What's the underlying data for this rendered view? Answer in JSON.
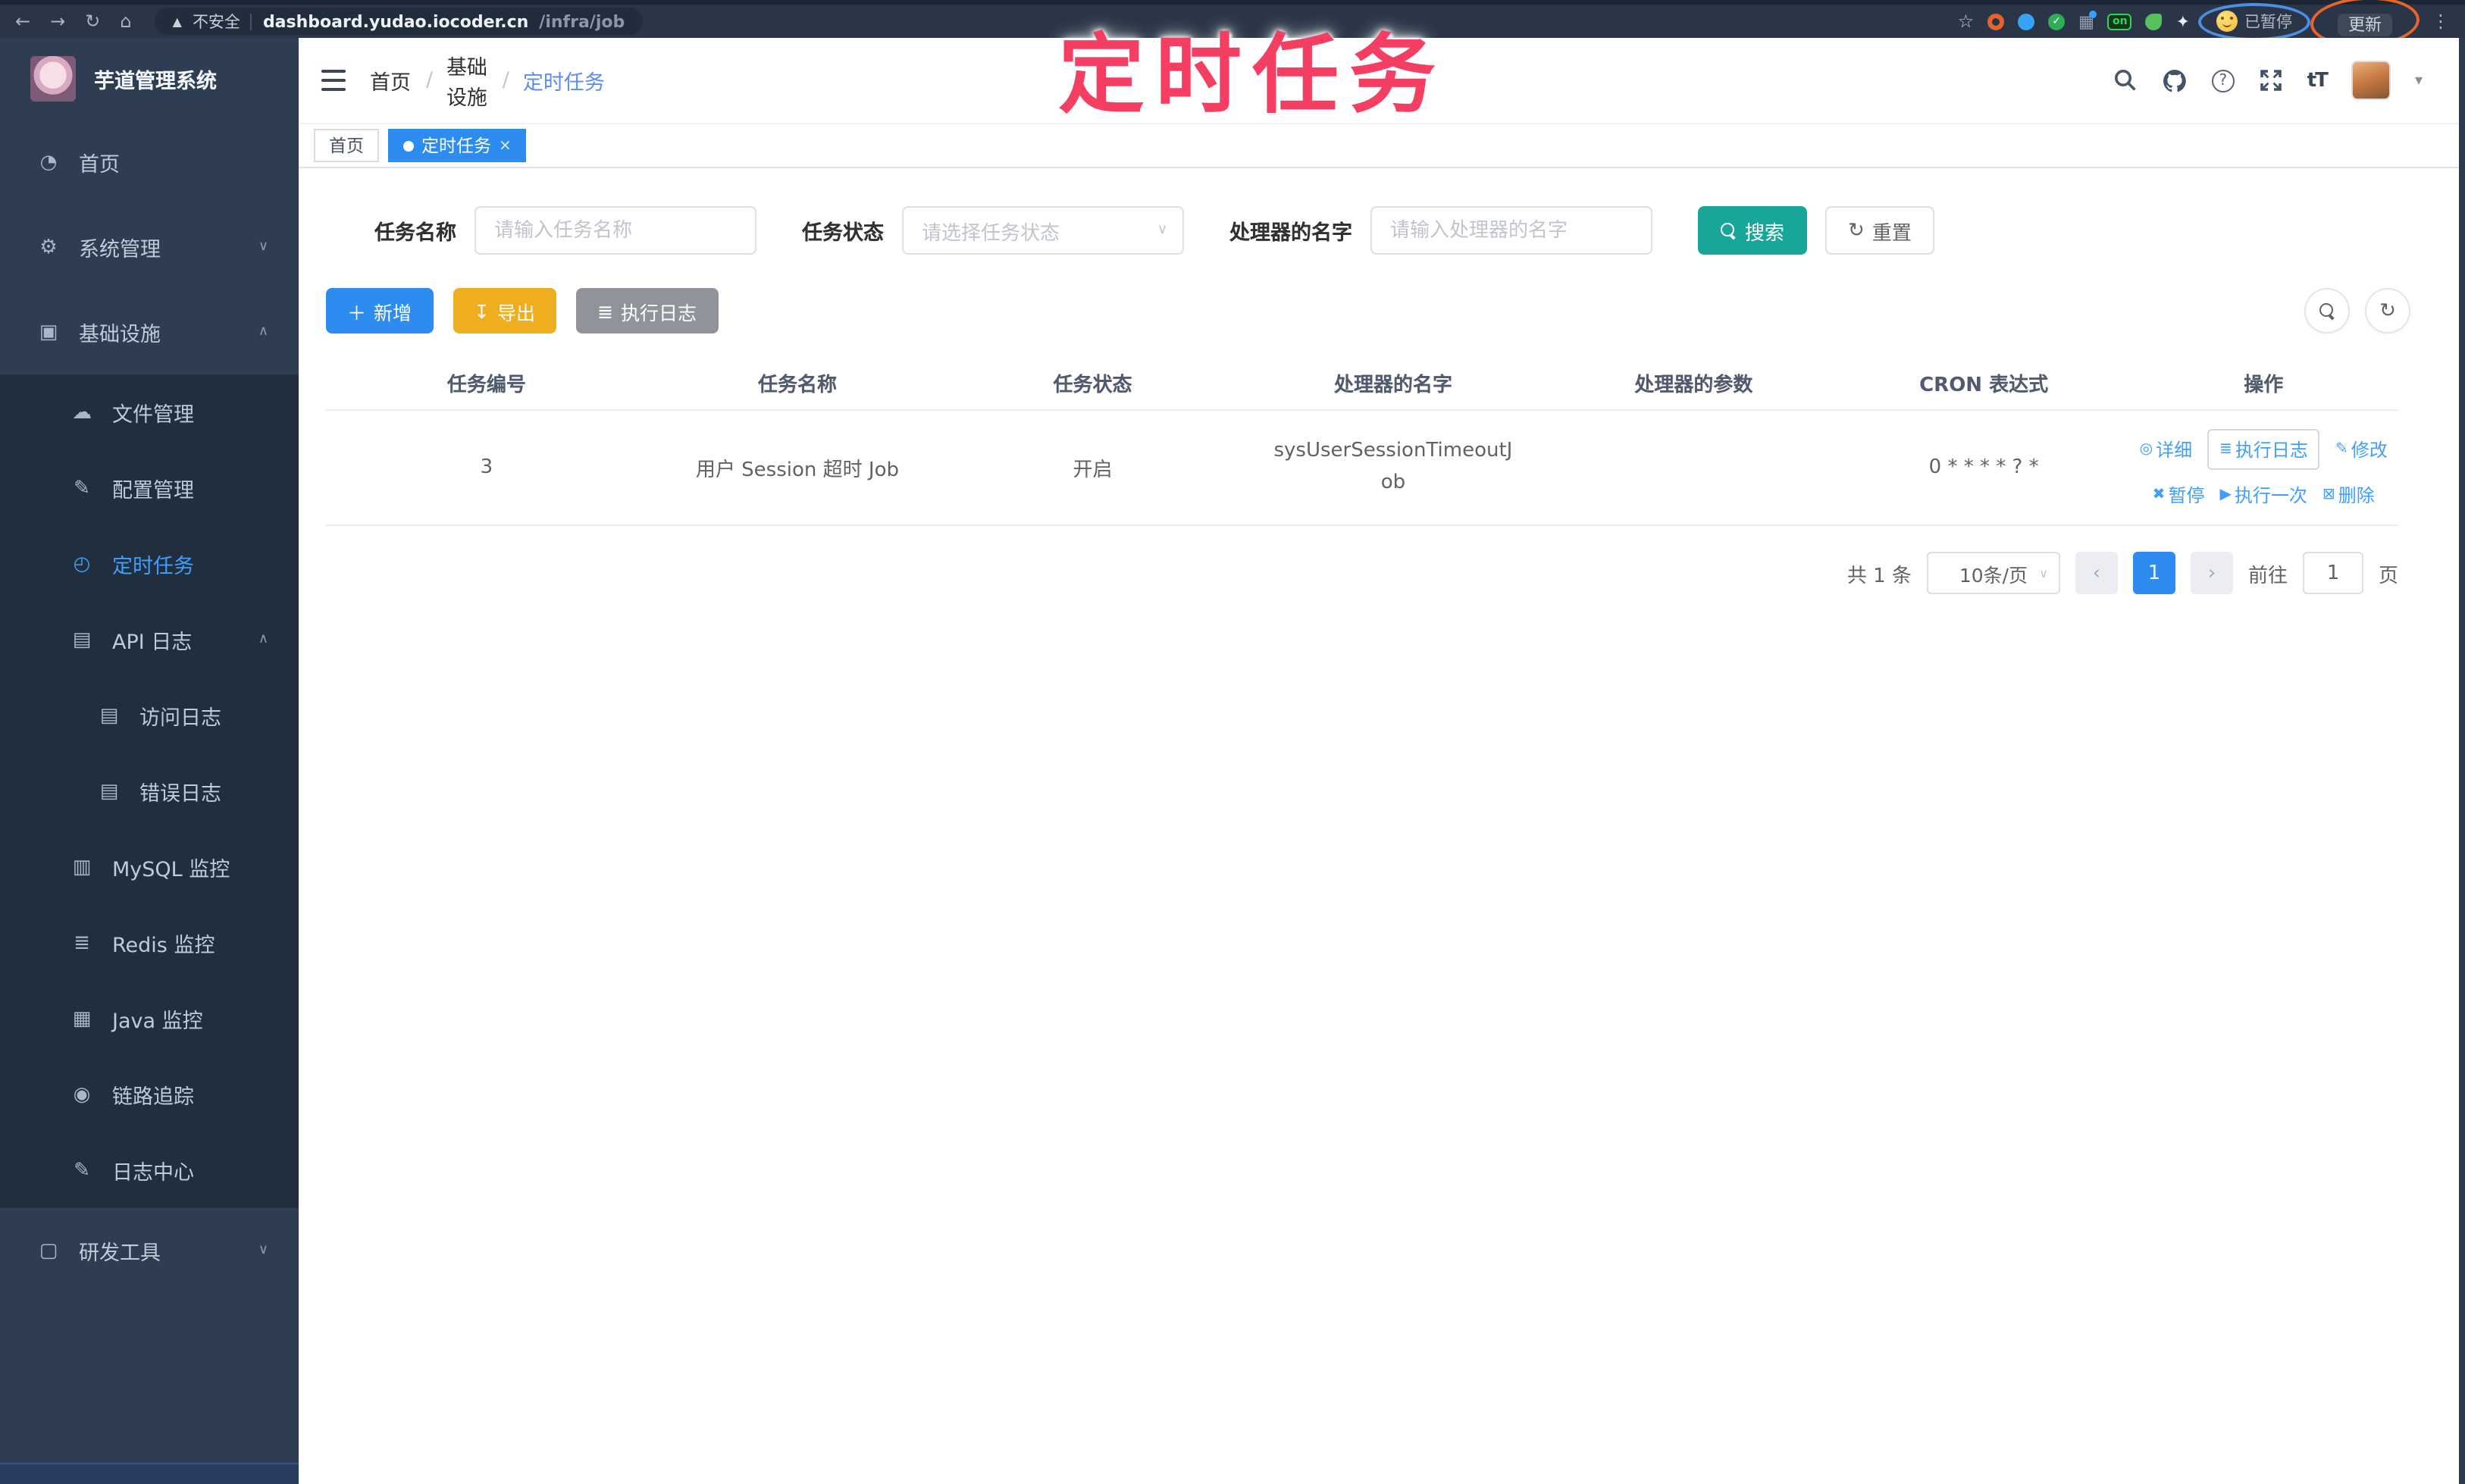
{
  "colors": {
    "primary_button": "#2D8CF0",
    "link": "#409EFF",
    "search_button": "#17A697",
    "export_button": "#EFAD20",
    "log_button": "#909399",
    "annotation": "#F43F63",
    "sidebar_bg": "#2E3D52",
    "submenu_bg": "#202E3E",
    "active_tab": "#2D8CF0"
  },
  "browser": {
    "back": "←",
    "forward": "→",
    "reload": "↻",
    "home": "⌂",
    "security_icon": "▲",
    "security": "不安全",
    "url_domain": "dashboard.yudao.iocoder.cn",
    "url_path": "/infra/job",
    "bookmark_star": "☆",
    "green_check": "✓",
    "grid_icon": "▦",
    "puzzle_icon": "✦",
    "on_badge": "on",
    "paused": "已暂停",
    "update": "更新",
    "menu": "⋮"
  },
  "annotation": {
    "title": "定时任务"
  },
  "sidebar": {
    "title": "芋道管理系统",
    "chev_down": "∨",
    "chev_up": "∧",
    "items": [
      {
        "label": "首页",
        "icon": "◔"
      },
      {
        "label": "系统管理",
        "icon": "⚙"
      },
      {
        "label": "基础设施",
        "icon": "▣"
      },
      {
        "label": "文件管理",
        "icon": "☁"
      },
      {
        "label": "配置管理",
        "icon": "✎"
      },
      {
        "label": "定时任务",
        "icon": "◴"
      },
      {
        "label": "API 日志",
        "icon": "▤"
      },
      {
        "label": "访问日志",
        "icon": "▤"
      },
      {
        "label": "错误日志",
        "icon": "▤"
      },
      {
        "label": "MySQL 监控",
        "icon": "▥"
      },
      {
        "label": "Redis 监控",
        "icon": "≣"
      },
      {
        "label": "Java 监控",
        "icon": "▦"
      },
      {
        "label": "链路追踪",
        "icon": "◉"
      },
      {
        "label": "日志中心",
        "icon": "✎"
      },
      {
        "label": "研发工具",
        "icon": "▢"
      }
    ]
  },
  "header": {
    "breadcrumb": [
      "首页",
      "基础设施",
      "定时任务"
    ],
    "sep": "/",
    "font_icon": "tT",
    "caret": "▾",
    "tabs": [
      {
        "label": "首页"
      },
      {
        "label": "定时任务",
        "close": "×"
      }
    ]
  },
  "filters": {
    "name_label": "任务名称",
    "name_placeholder": "请输入任务名称",
    "status_label": "任务状态",
    "status_placeholder": "请选择任务状态",
    "select_caret": "∨",
    "handler_label": "处理器的名字",
    "handler_placeholder": "请输入处理器的名字",
    "search": "搜索",
    "reset": "重置",
    "reset_icon": "↻"
  },
  "toolbar": {
    "add": "新增",
    "add_icon": "＋",
    "export": "导出",
    "export_icon": "↧",
    "exec_log": "执行日志",
    "exec_log_icon": "≣",
    "refresh_icon": "↻"
  },
  "table": {
    "columns": [
      "任务编号",
      "任务名称",
      "任务状态",
      "处理器的名字",
      "处理器的参数",
      "CRON 表达式",
      "操作"
    ],
    "row": {
      "id": "3",
      "name": "用户 Session 超时 Job",
      "status": "开启",
      "handler": "sysUserSessionTimeoutJob",
      "param": "",
      "cron": "0 * * * * ? *"
    },
    "actions_row1": [
      {
        "icon": "◎",
        "label": "详细"
      },
      {
        "icon": "≣",
        "label": "执行日志"
      },
      {
        "icon": "✎",
        "label": "修改"
      }
    ],
    "actions_row2": [
      {
        "icon": "✖",
        "label": "暂停"
      },
      {
        "icon": "▶",
        "label": "执行一次"
      },
      {
        "icon": "⊠",
        "label": "删除"
      }
    ]
  },
  "pagination": {
    "total": "共 1 条",
    "per_page": "10条/页",
    "prev": "‹",
    "next": "›",
    "page": "1",
    "goto": "前往",
    "goto_value": "1",
    "unit": "页"
  }
}
